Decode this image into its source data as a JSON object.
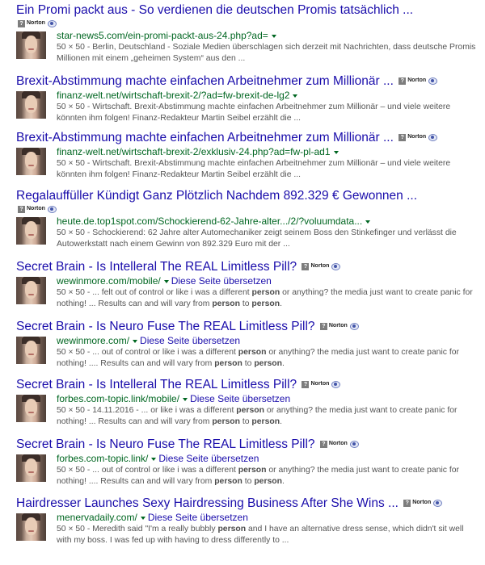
{
  "results": [
    {
      "title": "Ein Promi packt aus - So verdienen die deutschen Promis tatsächlich ...",
      "norton_label": "Norton",
      "norton_on_own_line": true,
      "url": "star-news5.com/ein-promi-packt-aus-24.php?ad=",
      "has_caret": true,
      "translate_label": "",
      "snippet": [
        {
          "text": "50 × 50 - Berlin, Deutschland - Soziale Medien überschlagen sich derzeit mit Nachrichten, dass deutsche Promis Millionen mit einem „geheimen System“ aus den ...",
          "bold": false
        }
      ]
    },
    {
      "title": "Brexit-Abstimmung machte einfachen Arbeitnehmer zum Millionär ...",
      "norton_label": "Norton",
      "norton_on_own_line": false,
      "url": "finanz-welt.net/wirtschaft-brexit-2/?ad=fw-brexit-de-lg2",
      "has_caret": true,
      "translate_label": "",
      "snippet": [
        {
          "text": "50 × 50 - Wirtschaft. Brexit-Abstimmung machte einfachen Arbeitnehmer zum Millionär – und viele weitere könnten ihm folgen! Finanz-Redakteur Martin Seibel erzählt die ...",
          "bold": false
        }
      ]
    },
    {
      "title": "Brexit-Abstimmung machte einfachen Arbeitnehmer zum Millionär ...",
      "norton_label": "Norton",
      "norton_on_own_line": false,
      "url": "finanz-welt.net/wirtschaft-brexit-2/exklusiv-24.php?ad=fw-pl-ad1",
      "has_caret": true,
      "translate_label": "",
      "snippet": [
        {
          "text": "50 × 50 - Wirtschaft. Brexit-Abstimmung machte einfachen Arbeitnehmer zum Millionär – und viele weitere könnten ihm folgen! Finanz-Redakteur Martin Seibel erzählt die ...",
          "bold": false
        }
      ]
    },
    {
      "title": "Regalauffüller Kündigt Ganz Plötzlich Nachdem 892.329 € Gewonnen ...",
      "norton_label": "Norton",
      "norton_on_own_line": true,
      "url": "heute.de.top1spot.com/Schockierend-62-Jahre-alter.../2/?voluumdata...",
      "has_caret": true,
      "translate_label": "",
      "snippet": [
        {
          "text": "50 × 50 - Schockierend: 62 Jahre alter Automechaniker zeigt seinem Boss den Stinkefinger und verlässt die Autowerkstatt nach einem Gewinn von 892.329 Euro mit der ...",
          "bold": false
        }
      ]
    },
    {
      "title": "Secret Brain - Is Intelleral The REAL Limitless Pill?",
      "norton_label": "Norton",
      "norton_on_own_line": false,
      "url": "wewinmore.com/mobile/",
      "has_caret": true,
      "translate_label": "Diese Seite übersetzen",
      "snippet": [
        {
          "text": "50 × 50 - ... felt out of control or like i was a different ",
          "bold": false
        },
        {
          "text": "person",
          "bold": true
        },
        {
          "text": " or anything? the media just want to create panic for nothing! ... Results can and will vary from ",
          "bold": false
        },
        {
          "text": "person",
          "bold": true
        },
        {
          "text": " to ",
          "bold": false
        },
        {
          "text": "person",
          "bold": true
        },
        {
          "text": ".",
          "bold": false
        }
      ]
    },
    {
      "title": "Secret Brain - Is Neuro Fuse The REAL Limitless Pill?",
      "norton_label": "Norton",
      "norton_on_own_line": false,
      "url": "wewinmore.com/",
      "has_caret": true,
      "translate_label": "Diese Seite übersetzen",
      "snippet": [
        {
          "text": "50 × 50 - ... out of control or like i was a different ",
          "bold": false
        },
        {
          "text": "person",
          "bold": true
        },
        {
          "text": " or anything? the media just want to create panic for nothing! .... Results can and will vary from ",
          "bold": false
        },
        {
          "text": "person",
          "bold": true
        },
        {
          "text": " to ",
          "bold": false
        },
        {
          "text": "person",
          "bold": true
        },
        {
          "text": ".",
          "bold": false
        }
      ]
    },
    {
      "title": "Secret Brain - Is Intelleral The REAL Limitless Pill?",
      "norton_label": "Norton",
      "norton_on_own_line": false,
      "url": "forbes.com-topic.link/mobile/",
      "has_caret": true,
      "translate_label": "Diese Seite übersetzen",
      "snippet": [
        {
          "text": "50 × 50 - 14.11.2016 - ... or like i was a different ",
          "bold": false
        },
        {
          "text": "person",
          "bold": true
        },
        {
          "text": " or anything? the media just want to create panic for nothing! ... Results can and will vary from ",
          "bold": false
        },
        {
          "text": "person",
          "bold": true
        },
        {
          "text": " to ",
          "bold": false
        },
        {
          "text": "person",
          "bold": true
        },
        {
          "text": ".",
          "bold": false
        }
      ]
    },
    {
      "title": "Secret Brain - Is Neuro Fuse The REAL Limitless Pill?",
      "norton_label": "Norton",
      "norton_on_own_line": false,
      "url": "forbes.com-topic.link/",
      "has_caret": true,
      "translate_label": "Diese Seite übersetzen",
      "snippet": [
        {
          "text": "50 × 50 - ... out of control or like i was a different ",
          "bold": false
        },
        {
          "text": "person",
          "bold": true
        },
        {
          "text": " or anything? the media just want to create panic for nothing! .... Results can and will vary from ",
          "bold": false
        },
        {
          "text": "person",
          "bold": true
        },
        {
          "text": " to ",
          "bold": false
        },
        {
          "text": "person",
          "bold": true
        },
        {
          "text": ".",
          "bold": false
        }
      ]
    },
    {
      "title": "Hairdresser Launches Sexy Hairdressing Business After She Wins ...",
      "norton_label": "Norton",
      "norton_on_own_line": false,
      "url": "menervadaily.com/",
      "has_caret": true,
      "translate_label": "Diese Seite übersetzen",
      "snippet": [
        {
          "text": "50 × 50 - Meredith said \"I'm a really bubbly ",
          "bold": false
        },
        {
          "text": "person",
          "bold": true
        },
        {
          "text": " and I have an alternative dress sense, which didn't sit well with my boss. I was fed up with having to dress differently to ...",
          "bold": false
        }
      ]
    }
  ],
  "colors": {
    "title": "#1a0dab",
    "url": "#006621",
    "snippet": "#545454"
  },
  "icons": {
    "norton": "norton-badge-icon",
    "eye": "eye-icon",
    "caret": "caret-down-icon",
    "thumbnail": "thumbnail-image"
  }
}
